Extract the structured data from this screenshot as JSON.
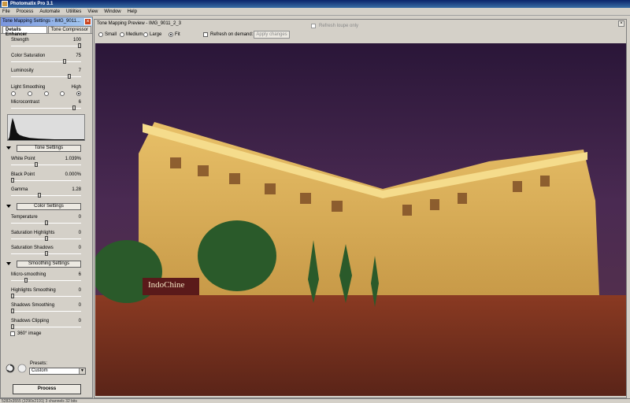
{
  "app": {
    "title": "Photomatix Pro 3.1"
  },
  "menu": [
    "File",
    "Process",
    "Automate",
    "Utilities",
    "View",
    "Window",
    "Help"
  ],
  "panel": {
    "title": "Tone Mapping Settings - IMG_9011...",
    "tabs": [
      "Details Enhancer",
      "Tone Compressor"
    ],
    "sliders_top": [
      {
        "label": "Strength",
        "value": "100",
        "pos": 1.0
      },
      {
        "label": "Color Saturation",
        "value": "75",
        "pos": 0.78
      },
      {
        "label": "Luminosity",
        "value": "7",
        "pos": 0.85
      },
      {
        "label": "Microcontrast",
        "value": "6",
        "pos": 0.92
      }
    ],
    "light_smoothing": {
      "label": "Light Smoothing",
      "high_label": "High",
      "selected": 4,
      "count": 5
    },
    "tone_settings": {
      "header": "Tone Settings",
      "sliders": [
        {
          "label": "White Point",
          "value": "1.039%",
          "pos": 0.35
        },
        {
          "label": "Black Point",
          "value": "0.000%",
          "pos": 0.0
        },
        {
          "label": "Gamma",
          "value": "1.28",
          "pos": 0.4
        }
      ]
    },
    "color_settings": {
      "header": "Color Settings",
      "sliders": [
        {
          "label": "Temperature",
          "value": "0",
          "pos": 0.5
        },
        {
          "label": "Saturation Highlights",
          "value": "0",
          "pos": 0.5
        },
        {
          "label": "Saturation Shadows",
          "value": "0",
          "pos": 0.5
        }
      ]
    },
    "smoothing_settings": {
      "header": "Smoothing Settings",
      "sliders": [
        {
          "label": "Micro-smoothing",
          "value": "6",
          "pos": 0.2
        },
        {
          "label": "Highlights Smoothing",
          "value": "0",
          "pos": 0.0
        },
        {
          "label": "Shadows Smoothing",
          "value": "0",
          "pos": 0.0
        },
        {
          "label": "Shadows Clipping",
          "value": "0",
          "pos": 0.0
        }
      ]
    },
    "image_360_label": "360° image",
    "presets_label": "Presets:",
    "preset_value": "Custom",
    "process_label": "Process"
  },
  "preview": {
    "title": "Tone Mapping Preview - IMG_9011_2_3",
    "sizes": [
      "Small",
      "Medium",
      "Large",
      "Fit"
    ],
    "selected_size": "Fit",
    "refresh_label": "Refresh on demand:",
    "apply_label": "Apply changes",
    "refresh_loupe_label": "Refresh loupe only",
    "sign_text": "IndoChine"
  },
  "status": "5282x3555 (3290x2191) 3 channels 32 bits",
  "colors": {
    "title_blue": "#0a246a",
    "panel_bg": "#d4d0c8",
    "accent_close": "#c8421e"
  }
}
